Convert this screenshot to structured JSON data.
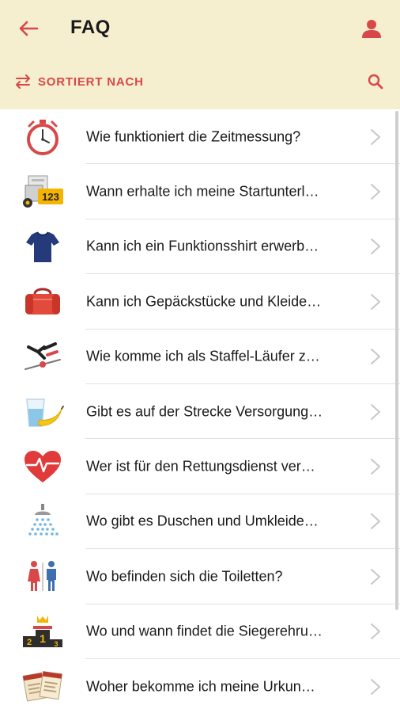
{
  "header": {
    "title": "FAQ",
    "back_icon": "arrow-left-icon",
    "profile_icon": "person-icon",
    "sort_label": "SORTIERT NACH",
    "sort_icon": "swap-arrows-icon",
    "search_icon": "search-icon"
  },
  "colors": {
    "accent": "#d84848",
    "header_bg": "#f5efd0",
    "divider": "#e2e2e2",
    "chevron": "#c8c8c8"
  },
  "faq": [
    {
      "icon": "stopwatch-icon",
      "question": "Wie funktioniert die Zeitmessung?"
    },
    {
      "icon": "start-documents-icon",
      "question": "Wann erhalte ich meine Startunterl…"
    },
    {
      "icon": "tshirt-icon",
      "question": "Kann ich ein Funktionsshirt erwerb…"
    },
    {
      "icon": "duffel-bag-icon",
      "question": "Kann ich Gepäckstücke und Kleide…"
    },
    {
      "icon": "relay-handover-icon",
      "question": "Wie komme ich als Staffel-Läufer z…"
    },
    {
      "icon": "water-banana-icon",
      "question": "Gibt es auf der Strecke Versorgung…"
    },
    {
      "icon": "heartbeat-icon",
      "question": "Wer ist für den Rettungsdienst ver…"
    },
    {
      "icon": "shower-icon",
      "question": "Wo gibt es Duschen und Umkleide…"
    },
    {
      "icon": "toilet-icon",
      "question": "Wo befinden sich die Toiletten?"
    },
    {
      "icon": "podium-icon",
      "question": "Wo und wann findet die Siegerehru…"
    },
    {
      "icon": "certificate-icon",
      "question": "Woher bekomme ich meine Urkun…"
    }
  ]
}
